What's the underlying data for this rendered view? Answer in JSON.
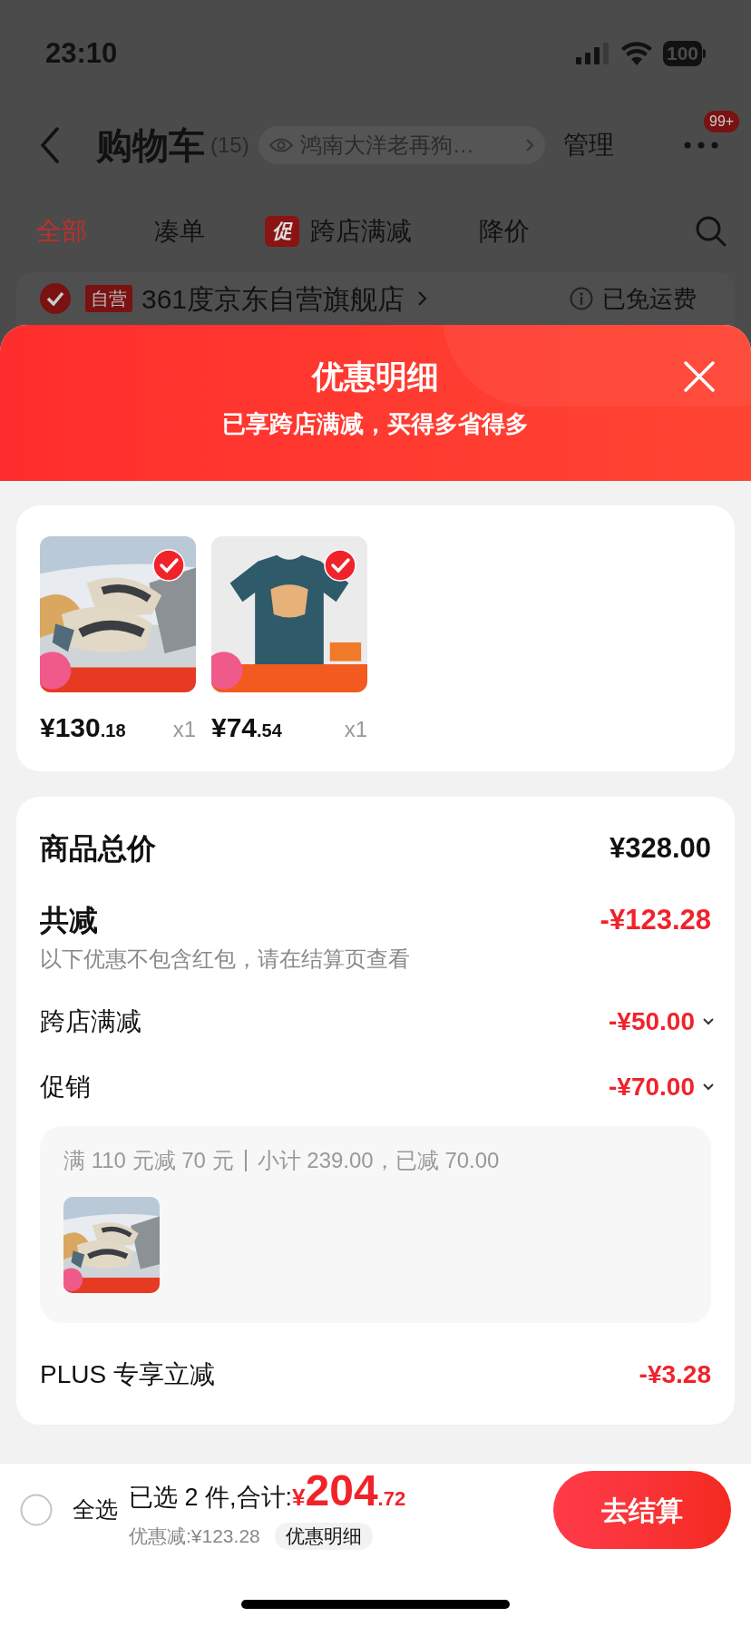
{
  "status_bar": {
    "time": "23:10",
    "battery": "100"
  },
  "nav": {
    "title": "购物车",
    "count": "(15)",
    "address": "鸿南大洋老再狗…",
    "manage": "管理",
    "more_badge": "99+"
  },
  "tabs": [
    {
      "label": "全部",
      "selected": true
    },
    {
      "label": "凑单",
      "selected": false
    },
    {
      "label": "跨店满减",
      "badge": "促",
      "selected": false
    },
    {
      "label": "降价",
      "selected": false
    }
  ],
  "store": {
    "checked": true,
    "tag": "自营",
    "name": "361度京东自营旗舰店",
    "shipping": "已免运费"
  },
  "sheet": {
    "title": "优惠明细",
    "subtitle": "已享跨店满减，买得多省得多"
  },
  "items": [
    {
      "kind": "picture",
      "checked": true,
      "price_int": "¥130",
      "price_dec": ".18",
      "qty": "x1"
    },
    {
      "kind": "picture",
      "checked": true,
      "price_int": "¥74",
      "price_dec": ".54",
      "qty": "x1"
    }
  ],
  "total": {
    "label": "商品总价",
    "value": "¥328.00"
  },
  "discount_total": {
    "label": "共减",
    "value": "-¥123.28",
    "note": "以下优惠不包含红包，请在结算页查看"
  },
  "discounts": [
    {
      "label": "跨店满减",
      "value": "-¥50.00",
      "expandable": true
    },
    {
      "label": "促销",
      "value": "-¥70.00",
      "expandable": true,
      "detail": {
        "rule": "满 110 元减 70 元",
        "subtotal": "小计 239.00，已减 70.00"
      }
    },
    {
      "label": "PLUS 专享立减",
      "value": "-¥3.28",
      "expandable": false
    }
  ],
  "bottom_bar": {
    "select_all": {
      "label": "全选",
      "checked": false
    },
    "selected": "已选 2 件,合计:",
    "currency": "¥",
    "total_int": "204",
    "total_dec": ".72",
    "saved": "优惠减:¥123.28",
    "detail_button": "优惠明细",
    "checkout": "去结算"
  }
}
